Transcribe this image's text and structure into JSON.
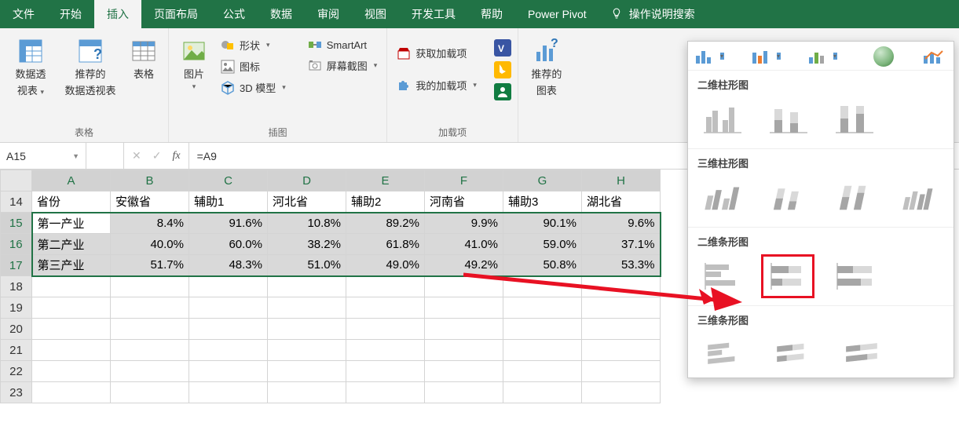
{
  "ribbon_tabs": {
    "file": "文件",
    "home": "开始",
    "insert": "插入",
    "layout": "页面布局",
    "formulas": "公式",
    "data": "数据",
    "review": "审阅",
    "view": "视图",
    "dev": "开发工具",
    "help": "帮助",
    "powerpivot": "Power Pivot",
    "search": "操作说明搜索"
  },
  "ribbon": {
    "tables": {
      "pivot_l1": "数据透",
      "pivot_l2": "视表",
      "recpivot_l1": "推荐的",
      "recpivot_l2": "数据透视表",
      "table": "表格",
      "group": "表格"
    },
    "illus": {
      "pictures": "图片",
      "shapes": "形状",
      "icons": "图标",
      "model3d": "3D 模型",
      "smartart": "SmartArt",
      "screenshot": "屏幕截图",
      "group": "插图"
    },
    "addins": {
      "get": "获取加载项",
      "my": "我的加载项",
      "group": "加载项"
    },
    "charts": {
      "rec_l1": "推荐的",
      "rec_l2": "图表"
    }
  },
  "panel": {
    "col2d": "二维柱形图",
    "col3d": "三维柱形图",
    "bar2d": "二维条形图",
    "bar3d": "三维条形图"
  },
  "formula_bar": {
    "name": "A15",
    "formula": "=A9"
  },
  "sheet": {
    "cols": [
      "A",
      "B",
      "C",
      "D",
      "E",
      "F",
      "G",
      "H"
    ],
    "row_start": 14,
    "headers": [
      "省份",
      "安徽省",
      "辅助1",
      "河北省",
      "辅助2",
      "河南省",
      "辅助3",
      "湖北省"
    ],
    "rows": [
      {
        "r": 15,
        "label": "第一产业",
        "vals": [
          "8.4%",
          "91.6%",
          "10.8%",
          "89.2%",
          "9.9%",
          "90.1%",
          "9.6%"
        ]
      },
      {
        "r": 16,
        "label": "第二产业",
        "vals": [
          "40.0%",
          "60.0%",
          "38.2%",
          "61.8%",
          "41.0%",
          "59.0%",
          "37.1%"
        ]
      },
      {
        "r": 17,
        "label": "第三产业",
        "vals": [
          "51.7%",
          "48.3%",
          "51.0%",
          "49.0%",
          "49.2%",
          "50.8%",
          "53.3%"
        ]
      }
    ],
    "blank_rows": [
      18,
      19,
      20,
      21,
      22,
      23
    ]
  }
}
